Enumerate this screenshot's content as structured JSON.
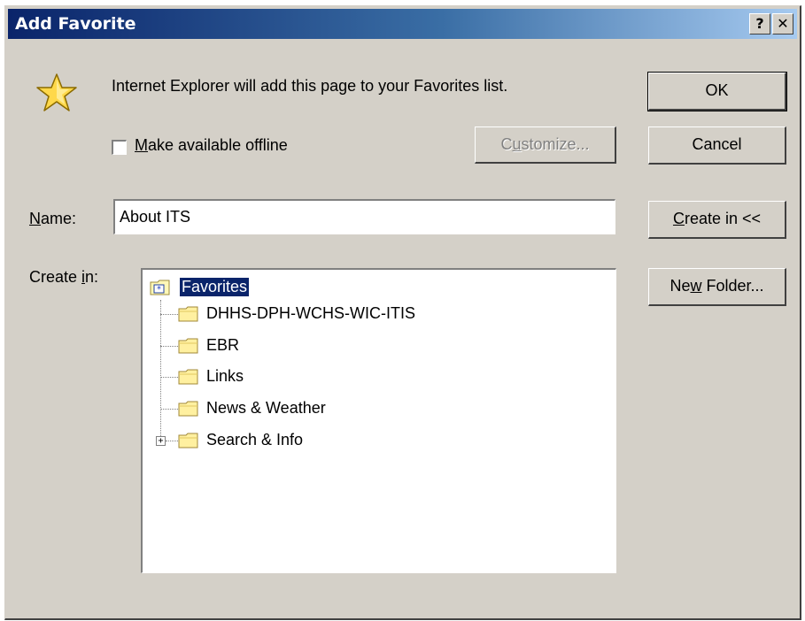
{
  "window": {
    "title": "Add Favorite",
    "help_label": "?",
    "close_label": "✕"
  },
  "message": "Internet Explorer will add this page to your Favorites list.",
  "offline": {
    "mnemonic": "M",
    "label_rest": "ake available offline",
    "checked": false
  },
  "buttons": {
    "ok": "OK",
    "cancel": "Cancel",
    "customize": {
      "pre": "C",
      "mnemonic": "u",
      "post": "stomize..."
    },
    "create_in": {
      "mnemonic": "C",
      "post": "reate in <<"
    },
    "new_folder": {
      "pre": "Ne",
      "mnemonic": "w",
      "post": " Folder..."
    }
  },
  "name": {
    "mnemonic": "N",
    "label_rest": "ame:",
    "value": "About ITS"
  },
  "create_in_label": {
    "pre": "Create ",
    "mnemonic": "i",
    "post": "n:"
  },
  "tree": {
    "root": "Favorites",
    "folders": [
      {
        "label": "DHHS-DPH-WCHS-WIC-ITIS",
        "expandable": false
      },
      {
        "label": "EBR",
        "expandable": false
      },
      {
        "label": "Links",
        "expandable": false
      },
      {
        "label": "News & Weather",
        "expandable": false
      },
      {
        "label": "Search & Info",
        "expandable": true
      }
    ],
    "expand_glyph": "+"
  },
  "colors": {
    "title_start": "#0a246a",
    "title_end": "#a6caf0",
    "face": "#d4d0c8",
    "selection": "#0a246a"
  }
}
